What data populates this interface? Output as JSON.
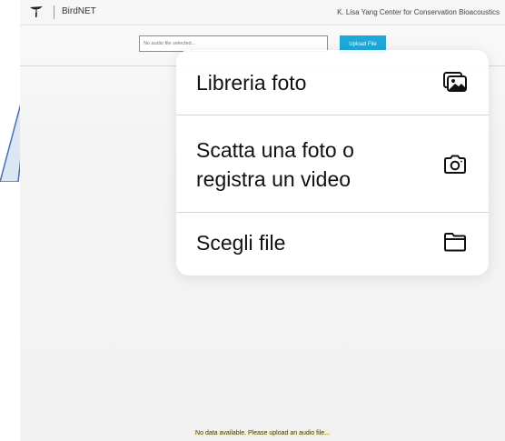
{
  "header": {
    "app_name": "BirdNET",
    "org_name": "K. Lisa Yang Center for Conservation Bioacoustics"
  },
  "upload": {
    "file_placeholder": "No audio file selected...",
    "button_label": "Upload File"
  },
  "status": {
    "message": "No data available. Please upload an audio file..."
  },
  "file_picker_menu": {
    "items": [
      {
        "label": "Libreria foto",
        "icon": "photo-library-icon"
      },
      {
        "label_line1": "Scatta una foto o",
        "label_line2": "registra un video",
        "icon": "camera-icon"
      },
      {
        "label": "Scegli file",
        "icon": "folder-icon"
      }
    ]
  },
  "colors": {
    "accent": "#1ea9d6",
    "status_highlight": "#f9f2c8"
  }
}
